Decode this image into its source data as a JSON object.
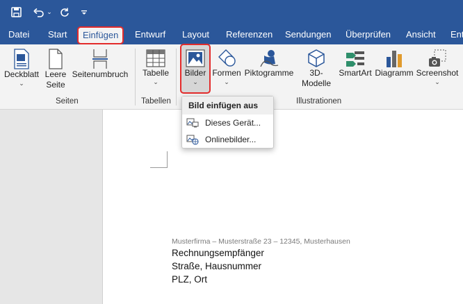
{
  "tabs": [
    "Datei",
    "Start",
    "Einfügen",
    "Entwurf",
    "Layout",
    "Referenzen",
    "Sendungen",
    "Überprüfen",
    "Ansicht",
    "Ent"
  ],
  "ribbon": {
    "deckblatt": "Deckblatt",
    "leere_seite_1": "Leere",
    "leere_seite_2": "Seite",
    "seitenumbruch": "Seitenumbruch",
    "tabelle": "Tabelle",
    "bilder": "Bilder",
    "formen": "Formen",
    "piktogramme": "Piktogramme",
    "modelle_1": "3D-",
    "modelle_2": "Modelle",
    "smartart": "SmartArt",
    "diagramm": "Diagramm",
    "screenshot": "Screenshot",
    "groups": {
      "seiten": "Seiten",
      "tabellen": "Tabellen",
      "illustrationen": "Illustrationen"
    },
    "chevron": "⌄"
  },
  "dropdown": {
    "title": "Bild einfügen aus",
    "items": [
      "Dieses Gerät...",
      "Onlinebilder..."
    ]
  },
  "document": {
    "sender": "Musterfirma – Musterstraße 23 – 12345, Musterhausen",
    "lines": [
      "Rechnungsempfänger",
      "Straße, Hausnummer",
      "PLZ, Ort"
    ]
  },
  "colors": {
    "accent": "#2b579a",
    "highlight": "#e32b2b",
    "ribbon": "#f3f3f3"
  },
  "icons": {
    "save": "save-icon",
    "undo": "undo-icon",
    "redo": "redo-icon",
    "customize": "customize-qat-icon"
  }
}
